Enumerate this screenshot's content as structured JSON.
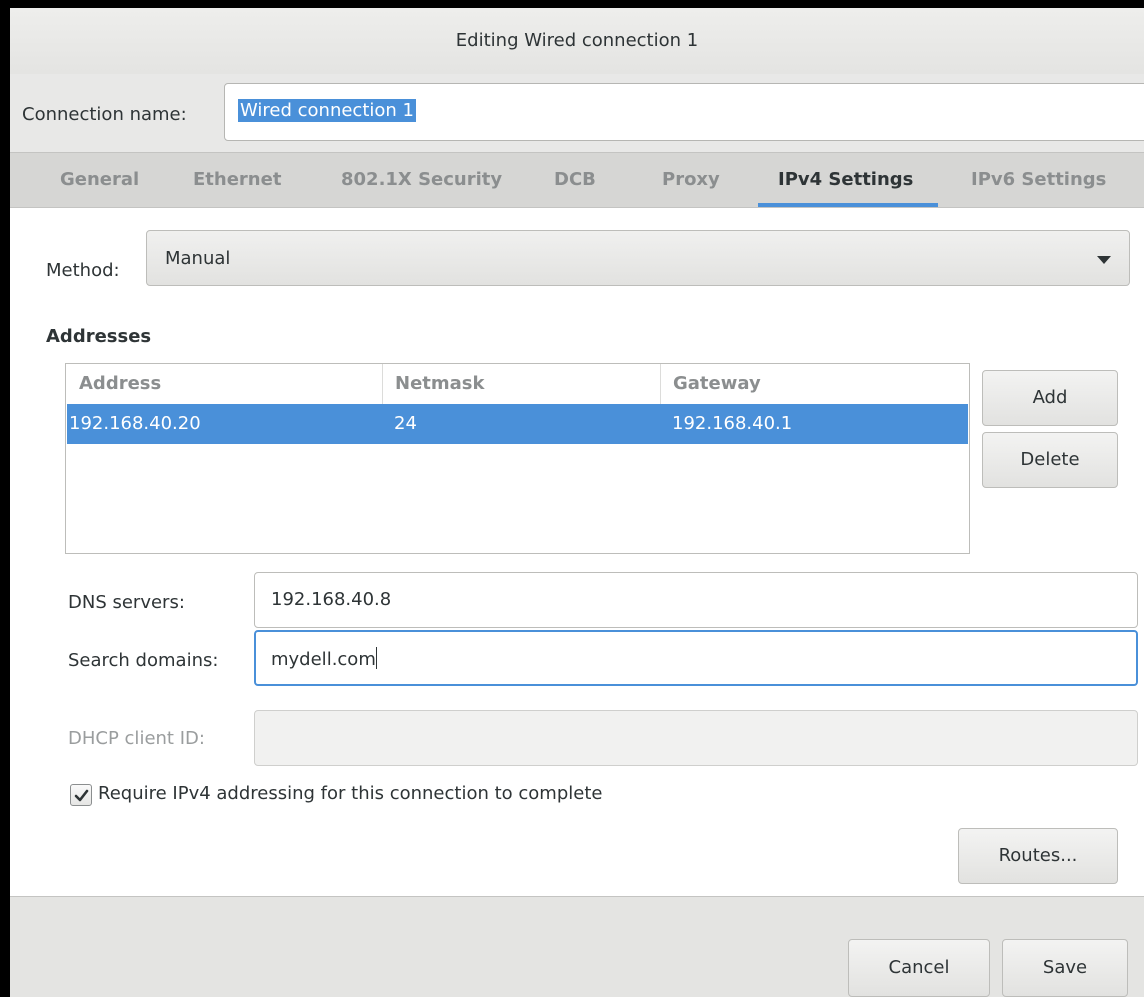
{
  "window": {
    "title": "Editing Wired connection 1"
  },
  "connection": {
    "label": "Connection name:",
    "value": "Wired connection 1"
  },
  "tabs": [
    {
      "label": "General"
    },
    {
      "label": "Ethernet"
    },
    {
      "label": "802.1X Security"
    },
    {
      "label": "DCB"
    },
    {
      "label": "Proxy"
    },
    {
      "label": "IPv4 Settings",
      "active": true
    },
    {
      "label": "IPv6 Settings"
    }
  ],
  "method": {
    "label": "Method:",
    "value": "Manual"
  },
  "addresses": {
    "label": "Addresses",
    "columns": [
      "Address",
      "Netmask",
      "Gateway"
    ],
    "rows": [
      {
        "address": "192.168.40.20",
        "netmask": "24",
        "gateway": "192.168.40.1"
      }
    ],
    "add_label": "Add",
    "delete_label": "Delete"
  },
  "dns": {
    "label": "DNS servers:",
    "value": "192.168.40.8"
  },
  "search": {
    "label": "Search domains:",
    "value": "mydell.com"
  },
  "dhcp": {
    "label": "DHCP client ID:",
    "value": ""
  },
  "require": {
    "label": "Require IPv4 addressing for this connection to complete",
    "checked": true
  },
  "routes_label": "Routes...",
  "footer": {
    "cancel_label": "Cancel",
    "save_label": "Save"
  },
  "colors": {
    "accent": "#4a90d9"
  }
}
